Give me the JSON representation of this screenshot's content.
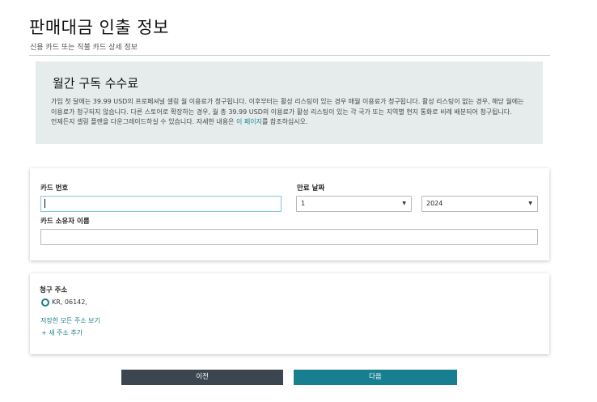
{
  "header": {
    "title": "판매대금 인출 정보",
    "subtitle": "신용 카드 또는 직불 카드 상세 정보"
  },
  "info_box": {
    "title": "월간 구독 수수료",
    "text": "가입 첫 달에는 39.99 USD의 프로페셔널 셀링 월 이용료가 청구됩니다. 이후부터는 활성 리스팅이 있는 경우 매월 이용료가 청구됩니다. 활성 리스팅이 없는 경우, 해당 월에는 이용료가 청구되지 않습니다. 다른 스토어로 확장하는 경우, 월 총 39.99 USD의 이용료가 활성 리스팅이 있는 각 국가 또는 지역별 현지 통화로 비례 배분되어 청구됩니다. 언제든지 셀링 플랜을 다운그레이드하실 수 있습니다. 자세한 내용은 ",
    "link_text": "이 페이지",
    "text_after": "를 참조하십시오."
  },
  "card_form": {
    "card_number_label": "카드 번호",
    "card_number_value": "",
    "expiry_label": "만료 날짜",
    "expiry_month": "1",
    "expiry_year": "2024",
    "holder_label": "카드 소유자 이름",
    "holder_value": ""
  },
  "billing": {
    "label": "청구 주소",
    "address": "KR, 06142,",
    "view_all_link": "저장한 모든 주소 보기",
    "add_new_link": "+ 새 주소 추가"
  },
  "footer": {
    "prev_label": "이전",
    "next_label": "다음"
  },
  "colors": {
    "accent": "#177f8f",
    "secondary_button": "#3b4651",
    "info_background": "#e6ebec"
  },
  "icons": {
    "select_chevron": "chevron-down-icon",
    "radio": "radio-selected-icon"
  }
}
